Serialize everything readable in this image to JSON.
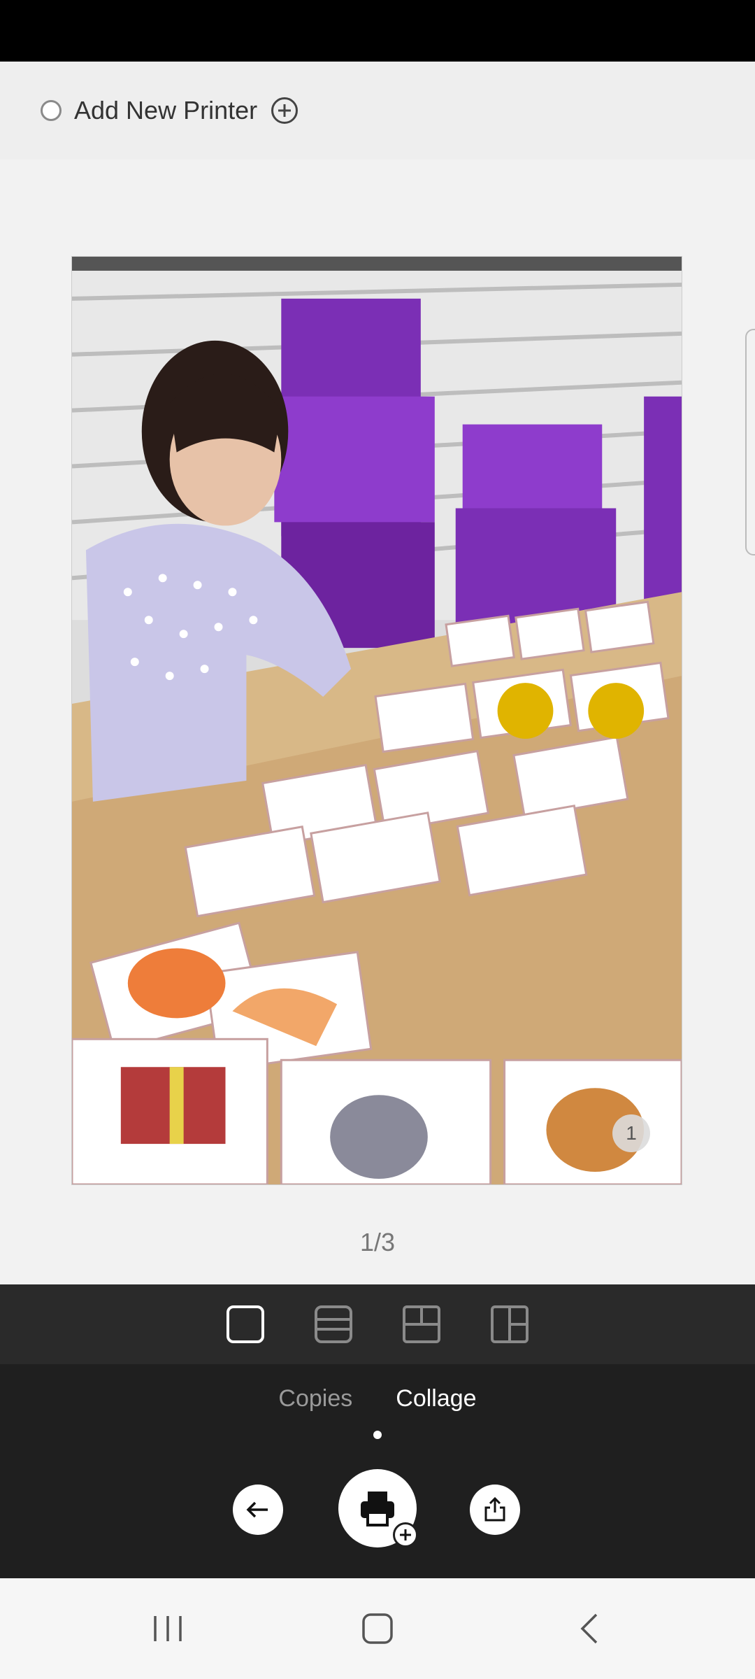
{
  "printer": {
    "label": "Add New Printer"
  },
  "preview": {
    "badge": "1",
    "page_indicator": "1/3"
  },
  "layouts": [
    {
      "name": "single"
    },
    {
      "name": "two-horizontal"
    },
    {
      "name": "three-grid"
    },
    {
      "name": "three-vertical"
    }
  ],
  "modes": {
    "copies": "Copies",
    "collage": "Collage",
    "active": "Collage"
  },
  "colors": {
    "panel": "#1f1f1f",
    "layout_bar": "#2a2a2a",
    "status_bar": "#000000",
    "accent_white": "#ffffff"
  }
}
